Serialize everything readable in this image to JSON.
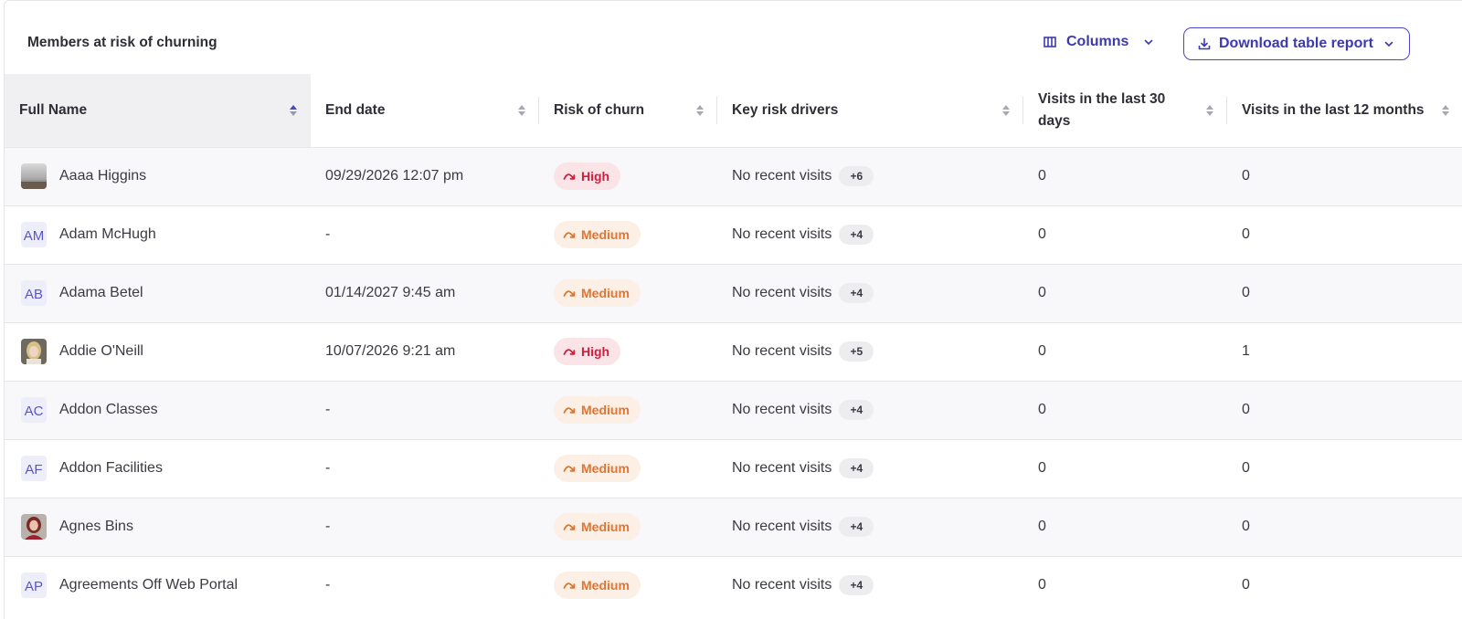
{
  "card": {
    "title": "Members at risk of churning",
    "columns_label": "Columns",
    "download_label": "Download table report"
  },
  "colors": {
    "accent": "#3d3ab0",
    "high_text": "#d11e3e",
    "high_bg": "#fbe4e8",
    "medium_text": "#e27530",
    "medium_bg": "#fcefe6"
  },
  "table": {
    "headers": [
      "Full Name",
      "End date",
      "Risk of churn",
      "Key risk drivers",
      "Visits in the last 30 days",
      "Visits in the last 12 months"
    ],
    "sorted_column": "Full Name",
    "rows": [
      {
        "name": "Aaaa Higgins",
        "avatar": {
          "kind": "photo",
          "icon": "photo-landscape"
        },
        "end_date": "09/29/2026 12:07 pm",
        "risk": "High",
        "risk_level": "high",
        "driver": "No recent visits",
        "more": "+6",
        "visits_30": "0",
        "visits_12m": "0"
      },
      {
        "name": "Adam McHugh",
        "avatar": {
          "kind": "initials",
          "text": "AM"
        },
        "end_date": "-",
        "risk": "Medium",
        "risk_level": "medium",
        "driver": "No recent visits",
        "more": "+4",
        "visits_30": "0",
        "visits_12m": "0"
      },
      {
        "name": "Adama Betel",
        "avatar": {
          "kind": "initials",
          "text": "AB"
        },
        "end_date": "01/14/2027 9:45 am",
        "risk": "Medium",
        "risk_level": "medium",
        "driver": "No recent visits",
        "more": "+4",
        "visits_30": "0",
        "visits_12m": "0"
      },
      {
        "name": "Addie O'Neill",
        "avatar": {
          "kind": "photo",
          "icon": "photo-blonde"
        },
        "end_date": "10/07/2026 9:21 am",
        "risk": "High",
        "risk_level": "high",
        "driver": "No recent visits",
        "more": "+5",
        "visits_30": "0",
        "visits_12m": "1"
      },
      {
        "name": "Addon Classes",
        "avatar": {
          "kind": "initials",
          "text": "AC"
        },
        "end_date": "-",
        "risk": "Medium",
        "risk_level": "medium",
        "driver": "No recent visits",
        "more": "+4",
        "visits_30": "0",
        "visits_12m": "0"
      },
      {
        "name": "Addon Facilities",
        "avatar": {
          "kind": "initials",
          "text": "AF"
        },
        "end_date": "-",
        "risk": "Medium",
        "risk_level": "medium",
        "driver": "No recent visits",
        "more": "+4",
        "visits_30": "0",
        "visits_12m": "0"
      },
      {
        "name": "Agnes Bins",
        "avatar": {
          "kind": "photo",
          "icon": "photo-redhead"
        },
        "end_date": "-",
        "risk": "Medium",
        "risk_level": "medium",
        "driver": "No recent visits",
        "more": "+4",
        "visits_30": "0",
        "visits_12m": "0"
      },
      {
        "name": "Agreements Off Web Portal",
        "avatar": {
          "kind": "initials",
          "text": "AP"
        },
        "end_date": "-",
        "risk": "Medium",
        "risk_level": "medium",
        "driver": "No recent visits",
        "more": "+4",
        "visits_30": "0",
        "visits_12m": "0"
      }
    ]
  }
}
